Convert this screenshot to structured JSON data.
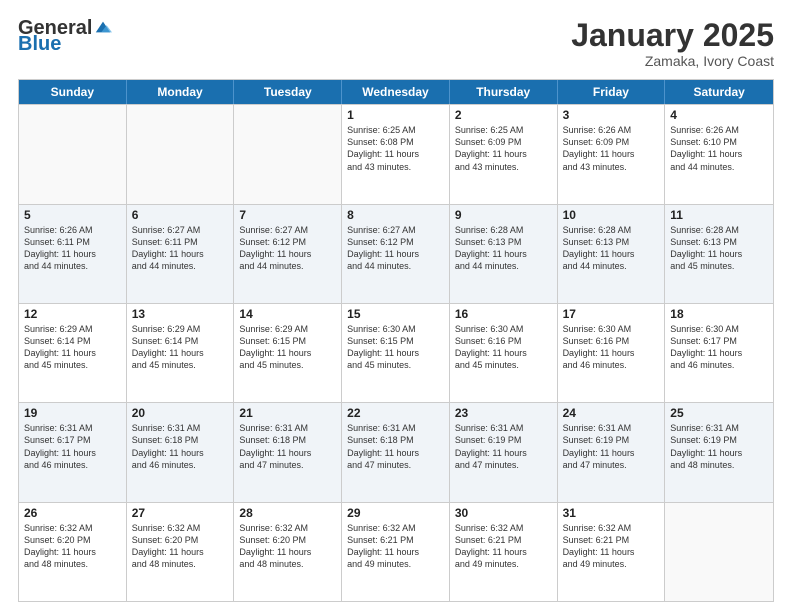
{
  "header": {
    "logo_general": "General",
    "logo_blue": "Blue",
    "title": "January 2025",
    "subtitle": "Zamaka, Ivory Coast"
  },
  "days_of_week": [
    "Sunday",
    "Monday",
    "Tuesday",
    "Wednesday",
    "Thursday",
    "Friday",
    "Saturday"
  ],
  "weeks": [
    [
      {
        "day": "",
        "info": "",
        "empty": true
      },
      {
        "day": "",
        "info": "",
        "empty": true
      },
      {
        "day": "",
        "info": "",
        "empty": true
      },
      {
        "day": "1",
        "info": "Sunrise: 6:25 AM\nSunset: 6:08 PM\nDaylight: 11 hours\nand 43 minutes."
      },
      {
        "day": "2",
        "info": "Sunrise: 6:25 AM\nSunset: 6:09 PM\nDaylight: 11 hours\nand 43 minutes."
      },
      {
        "day": "3",
        "info": "Sunrise: 6:26 AM\nSunset: 6:09 PM\nDaylight: 11 hours\nand 43 minutes."
      },
      {
        "day": "4",
        "info": "Sunrise: 6:26 AM\nSunset: 6:10 PM\nDaylight: 11 hours\nand 44 minutes."
      }
    ],
    [
      {
        "day": "5",
        "info": "Sunrise: 6:26 AM\nSunset: 6:11 PM\nDaylight: 11 hours\nand 44 minutes."
      },
      {
        "day": "6",
        "info": "Sunrise: 6:27 AM\nSunset: 6:11 PM\nDaylight: 11 hours\nand 44 minutes."
      },
      {
        "day": "7",
        "info": "Sunrise: 6:27 AM\nSunset: 6:12 PM\nDaylight: 11 hours\nand 44 minutes."
      },
      {
        "day": "8",
        "info": "Sunrise: 6:27 AM\nSunset: 6:12 PM\nDaylight: 11 hours\nand 44 minutes."
      },
      {
        "day": "9",
        "info": "Sunrise: 6:28 AM\nSunset: 6:13 PM\nDaylight: 11 hours\nand 44 minutes."
      },
      {
        "day": "10",
        "info": "Sunrise: 6:28 AM\nSunset: 6:13 PM\nDaylight: 11 hours\nand 44 minutes."
      },
      {
        "day": "11",
        "info": "Sunrise: 6:28 AM\nSunset: 6:13 PM\nDaylight: 11 hours\nand 45 minutes."
      }
    ],
    [
      {
        "day": "12",
        "info": "Sunrise: 6:29 AM\nSunset: 6:14 PM\nDaylight: 11 hours\nand 45 minutes."
      },
      {
        "day": "13",
        "info": "Sunrise: 6:29 AM\nSunset: 6:14 PM\nDaylight: 11 hours\nand 45 minutes."
      },
      {
        "day": "14",
        "info": "Sunrise: 6:29 AM\nSunset: 6:15 PM\nDaylight: 11 hours\nand 45 minutes."
      },
      {
        "day": "15",
        "info": "Sunrise: 6:30 AM\nSunset: 6:15 PM\nDaylight: 11 hours\nand 45 minutes."
      },
      {
        "day": "16",
        "info": "Sunrise: 6:30 AM\nSunset: 6:16 PM\nDaylight: 11 hours\nand 45 minutes."
      },
      {
        "day": "17",
        "info": "Sunrise: 6:30 AM\nSunset: 6:16 PM\nDaylight: 11 hours\nand 46 minutes."
      },
      {
        "day": "18",
        "info": "Sunrise: 6:30 AM\nSunset: 6:17 PM\nDaylight: 11 hours\nand 46 minutes."
      }
    ],
    [
      {
        "day": "19",
        "info": "Sunrise: 6:31 AM\nSunset: 6:17 PM\nDaylight: 11 hours\nand 46 minutes."
      },
      {
        "day": "20",
        "info": "Sunrise: 6:31 AM\nSunset: 6:18 PM\nDaylight: 11 hours\nand 46 minutes."
      },
      {
        "day": "21",
        "info": "Sunrise: 6:31 AM\nSunset: 6:18 PM\nDaylight: 11 hours\nand 47 minutes."
      },
      {
        "day": "22",
        "info": "Sunrise: 6:31 AM\nSunset: 6:18 PM\nDaylight: 11 hours\nand 47 minutes."
      },
      {
        "day": "23",
        "info": "Sunrise: 6:31 AM\nSunset: 6:19 PM\nDaylight: 11 hours\nand 47 minutes."
      },
      {
        "day": "24",
        "info": "Sunrise: 6:31 AM\nSunset: 6:19 PM\nDaylight: 11 hours\nand 47 minutes."
      },
      {
        "day": "25",
        "info": "Sunrise: 6:31 AM\nSunset: 6:19 PM\nDaylight: 11 hours\nand 48 minutes."
      }
    ],
    [
      {
        "day": "26",
        "info": "Sunrise: 6:32 AM\nSunset: 6:20 PM\nDaylight: 11 hours\nand 48 minutes."
      },
      {
        "day": "27",
        "info": "Sunrise: 6:32 AM\nSunset: 6:20 PM\nDaylight: 11 hours\nand 48 minutes."
      },
      {
        "day": "28",
        "info": "Sunrise: 6:32 AM\nSunset: 6:20 PM\nDaylight: 11 hours\nand 48 minutes."
      },
      {
        "day": "29",
        "info": "Sunrise: 6:32 AM\nSunset: 6:21 PM\nDaylight: 11 hours\nand 49 minutes."
      },
      {
        "day": "30",
        "info": "Sunrise: 6:32 AM\nSunset: 6:21 PM\nDaylight: 11 hours\nand 49 minutes."
      },
      {
        "day": "31",
        "info": "Sunrise: 6:32 AM\nSunset: 6:21 PM\nDaylight: 11 hours\nand 49 minutes."
      },
      {
        "day": "",
        "info": "",
        "empty": true
      }
    ]
  ]
}
